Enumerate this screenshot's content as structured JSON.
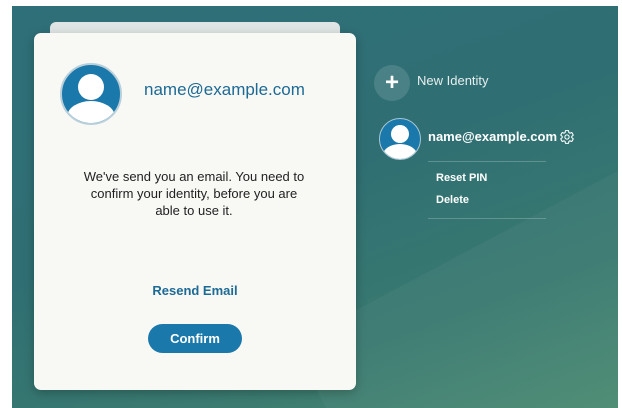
{
  "card": {
    "email": "name@example.com",
    "message": "We've send you an email. You need to confirm your identity, before you are able to use it.",
    "resend_label": "Resend Email",
    "confirm_label": "Confirm"
  },
  "sidebar": {
    "new_identity_label": "New Identity",
    "new_identity_icon": "plus-icon",
    "identity": {
      "email": "name@example.com",
      "settings_icon": "gear-icon",
      "menu": [
        {
          "label": "Reset PIN"
        },
        {
          "label": "Delete"
        }
      ]
    }
  },
  "colors": {
    "background": "#2f6f79",
    "card": "#f8f8f5",
    "accent": "#1b78ab",
    "link": "#1d6a94"
  }
}
